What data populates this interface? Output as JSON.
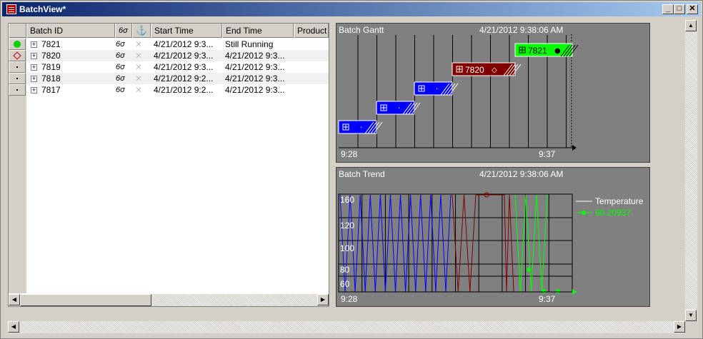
{
  "window": {
    "title": "BatchView*",
    "minimize_glyph": "_",
    "maximize_glyph": "□",
    "close_glyph": "✕"
  },
  "grid": {
    "columns": [
      {
        "label": "Batch ID"
      },
      {
        "label": "6σ"
      },
      {
        "label": "⚓"
      },
      {
        "label": "Start Time"
      },
      {
        "label": "End Time"
      },
      {
        "label": "Product"
      }
    ],
    "rows": [
      {
        "status_icon": "green-circle-icon",
        "id": "7821",
        "start": "4/21/2012 9:3...",
        "end": "Still Running"
      },
      {
        "status_icon": "red-diamond-icon",
        "id": "7820",
        "start": "4/21/2012 9:3...",
        "end": "4/21/2012 9:3..."
      },
      {
        "status_icon": "dot-icon",
        "id": "7819",
        "start": "4/21/2012 9:3...",
        "end": "4/21/2012 9:3..."
      },
      {
        "status_icon": "dot-icon",
        "id": "7818",
        "start": "4/21/2012 9:2...",
        "end": "4/21/2012 9:3..."
      },
      {
        "status_icon": "dot-icon",
        "id": "7817",
        "start": "4/21/2012 9:2...",
        "end": "4/21/2012 9:3..."
      }
    ],
    "sigma_glyph": "6σ",
    "tool_glyph": "✕",
    "expander_glyph": "+"
  },
  "gantt": {
    "title": "Batch Gantt",
    "timestamp": "4/21/2012 9:38:06 AM",
    "x_start_label": "9:28",
    "x_end_label": "9:37",
    "bars": [
      {
        "label": "",
        "marker": "·"
      },
      {
        "label": "",
        "marker": "·"
      },
      {
        "label": "",
        "marker": "·"
      },
      {
        "label": "7820",
        "marker": "◇"
      },
      {
        "label": "7821",
        "marker": "●"
      }
    ],
    "colors": {
      "blue": "#0000ff",
      "red": "#800000",
      "green": "#00ff00"
    }
  },
  "trend": {
    "title": "Batch Trend",
    "timestamp": "4/21/2012 9:38:06 AM",
    "x_start_label": "9:28",
    "x_end_label": "9:37",
    "y_ticks": [
      "160",
      "120",
      "100",
      "80",
      "60"
    ],
    "legend": [
      {
        "name": "Temperature",
        "color": "#ffffff"
      },
      {
        "name": "60.20937",
        "color": "#00ff00"
      }
    ]
  }
}
